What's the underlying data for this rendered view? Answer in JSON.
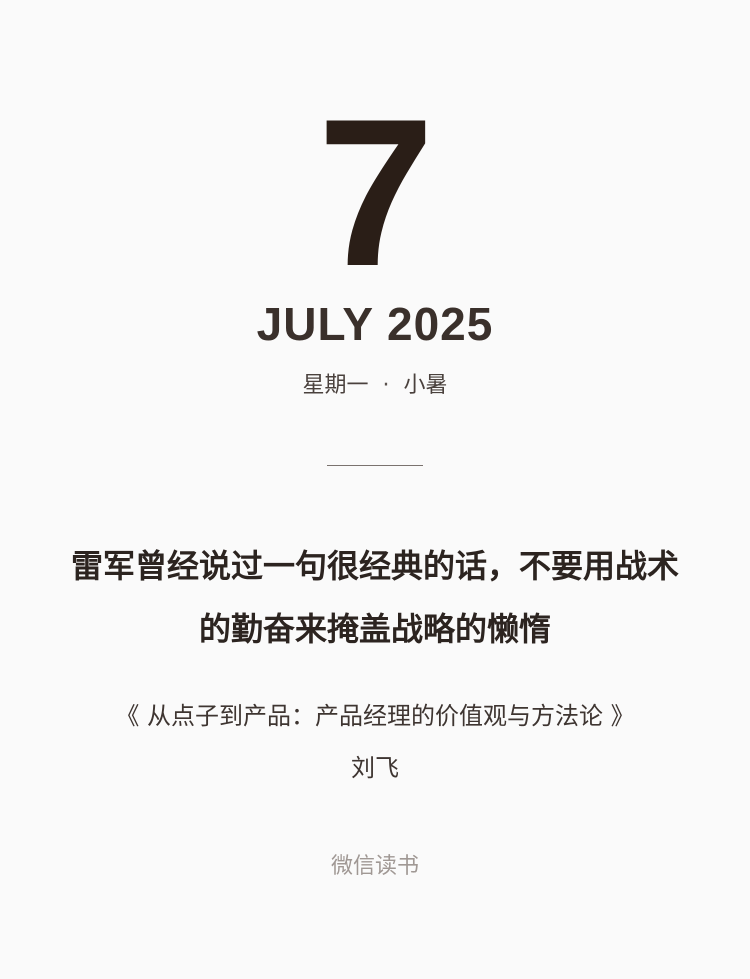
{
  "date": {
    "day": "7",
    "month_year": "JULY 2025",
    "weekday": "星期一",
    "separator": "·",
    "solar_term": "小暑"
  },
  "quote": {
    "text": "雷军曾经说过一句很经典的话，不要用战术的勤奋来掩盖战略的懒惰",
    "source": "《 从点子到产品：产品经理的价值观与方法论 》",
    "author": "刘飞"
  },
  "brand": {
    "name": "微信读书"
  },
  "colors": {
    "background": "#fafafa",
    "primary_text": "#2a1e17",
    "muted_text": "#a09894"
  }
}
